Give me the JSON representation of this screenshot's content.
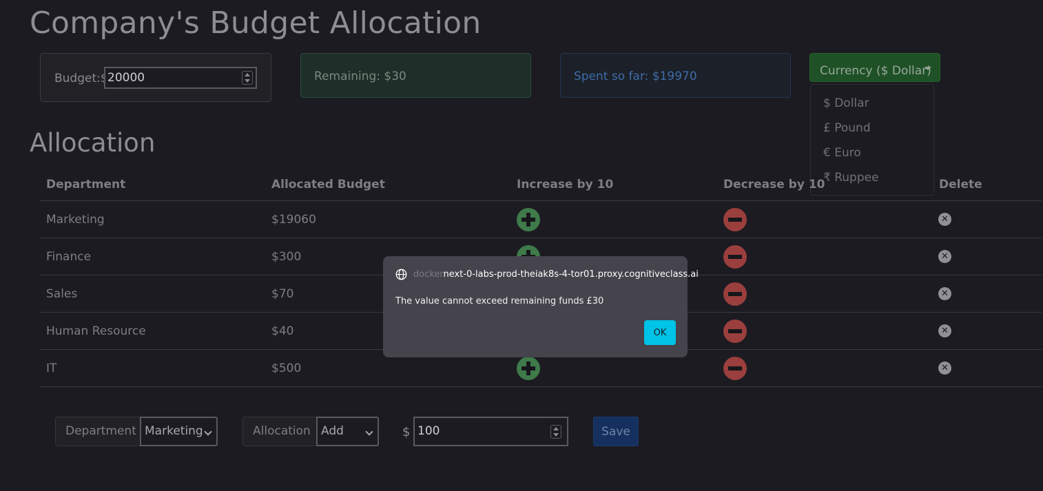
{
  "page": {
    "title": "Company's Budget Allocation",
    "allocation_heading": "Allocation"
  },
  "budget": {
    "label": "Budget:$",
    "value": "20000"
  },
  "remaining": {
    "text": "Remaining: $30"
  },
  "spent": {
    "text": "Spent so far: $19970"
  },
  "currency": {
    "button_label": "Currency ($ Dollar)",
    "options": [
      "$ Dollar",
      "£ Pound",
      "€ Euro",
      "₹ Ruppee"
    ]
  },
  "table": {
    "headers": [
      "Department",
      "Allocated Budget",
      "Increase by 10",
      "Decrease by 10",
      "Delete"
    ],
    "rows": [
      {
        "department": "Marketing",
        "budget": "$19060"
      },
      {
        "department": "Finance",
        "budget": "$300"
      },
      {
        "department": "Sales",
        "budget": "$70"
      },
      {
        "department": "Human Resource",
        "budget": "$40"
      },
      {
        "department": "IT",
        "budget": "$500"
      }
    ]
  },
  "form": {
    "department_label": "Department",
    "department_selected": "Marketing",
    "allocation_label": "Allocation",
    "allocation_selected": "Add",
    "currency_symbol": "$",
    "amount_value": "100",
    "save_label": "Save"
  },
  "dialog": {
    "origin_faded": "docker",
    "origin_main": "next-0-labs-prod-theiak8s-4-tor01.proxy.cognitiveclass.ai",
    "message": "The value cannot exceed remaining funds  £30",
    "ok_label": "OK"
  },
  "colors": {
    "background": "#1c1b21",
    "increase": "#3e7a4a",
    "decrease": "#9a3f3d",
    "currency_button": "#1f5126",
    "save_button": "#15305e",
    "ok_button": "#00c3e8"
  }
}
